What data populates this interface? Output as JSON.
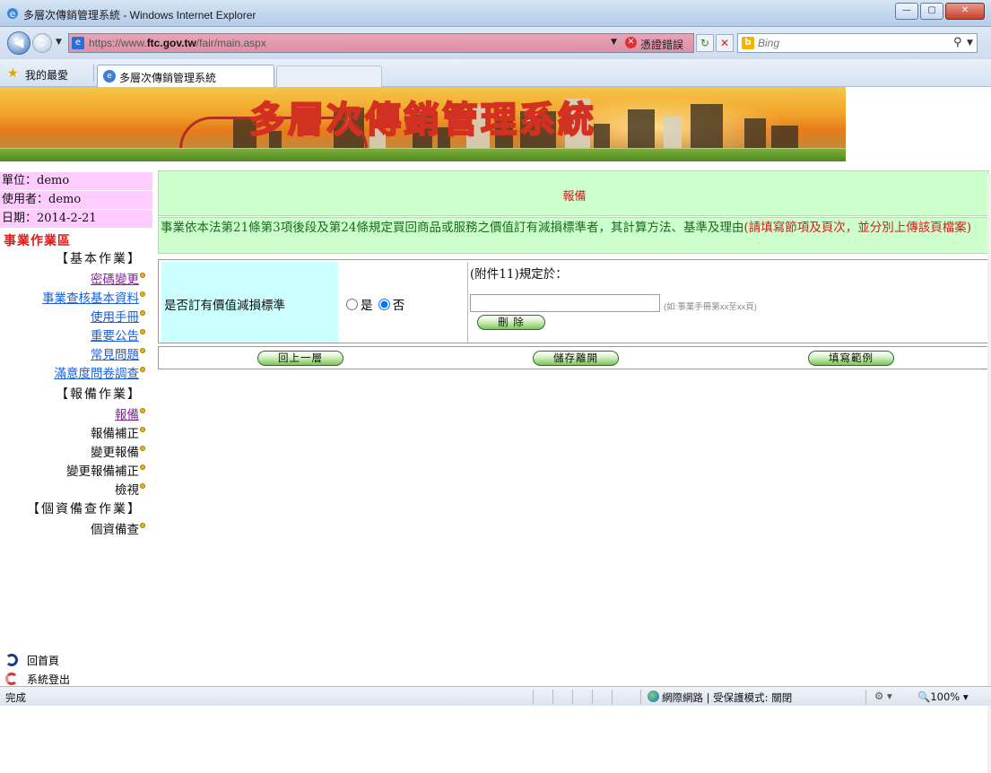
{
  "window": {
    "title": "多層次傳銷管理系統 - Windows Internet Explorer",
    "minimize_label": "—",
    "maximize_label": "▢",
    "close_label": "✕"
  },
  "address_bar": {
    "url_prefix": "https://www.",
    "url_host": "ftc.gov.tw",
    "url_path": "/fair/main.aspx",
    "cert_error_label": "憑證錯誤",
    "search_placeholder": "Bing"
  },
  "favorites_bar": {
    "favorites_label": "我的最愛",
    "active_tab_label": "多層次傳銷管理系統"
  },
  "banner": {
    "title": "多層次傳銷管理系統"
  },
  "sidebar": {
    "unit": "單位：demo",
    "user": "使用者：demo",
    "date": "日期：2014-2-21",
    "zone_title": "事業作業區",
    "basic_section": "【基本作業】",
    "basic_items": [
      "密碼變更",
      "事業查核基本資料",
      "使用手冊",
      "重要公告",
      "常見問題",
      "滿意度問卷調查"
    ],
    "report_section": "【報備作業】",
    "report_items": [
      "報備",
      "報備補正",
      "變更報備",
      "變更報備補正",
      "檢視"
    ],
    "privacy_section": "【個資備查作業】",
    "privacy_items": [
      "個資備查"
    ],
    "home_link": "回首頁",
    "logout_link": "系統登出"
  },
  "main": {
    "heading": "報備",
    "description_main": "事業依本法第21條第3項後段及第24條規定買回商品或服務之價值訂有減損標準者，其計算方法、基準及理由",
    "description_note": "(請填寫節項及頁次，並分別上傳該頁檔案)",
    "field_label": "是否訂有價值減損標準",
    "radio_yes": "是",
    "radio_no": "否",
    "selected_option": "否",
    "attachment_label": "(附件11)規定於：",
    "attachment_value": "",
    "attachment_hint": "(如:事業手冊第xx至xx頁)",
    "delete_button": "刪 除",
    "back_button": "回上一層",
    "save_button": "儲存離開",
    "example_button": "填寫範例"
  },
  "statusbar": {
    "status": "完成",
    "zone": "網際網路 | 受保護模式: 關閉",
    "zoom": "100%"
  },
  "colors": {
    "menu_link": "#1a5fd8",
    "visited_link": "#8a1fa0",
    "heading_red": "#d81a1a",
    "panel_green": "#ccffcc",
    "panel_cyan": "#ccffff",
    "info_pink": "#ffccff"
  }
}
